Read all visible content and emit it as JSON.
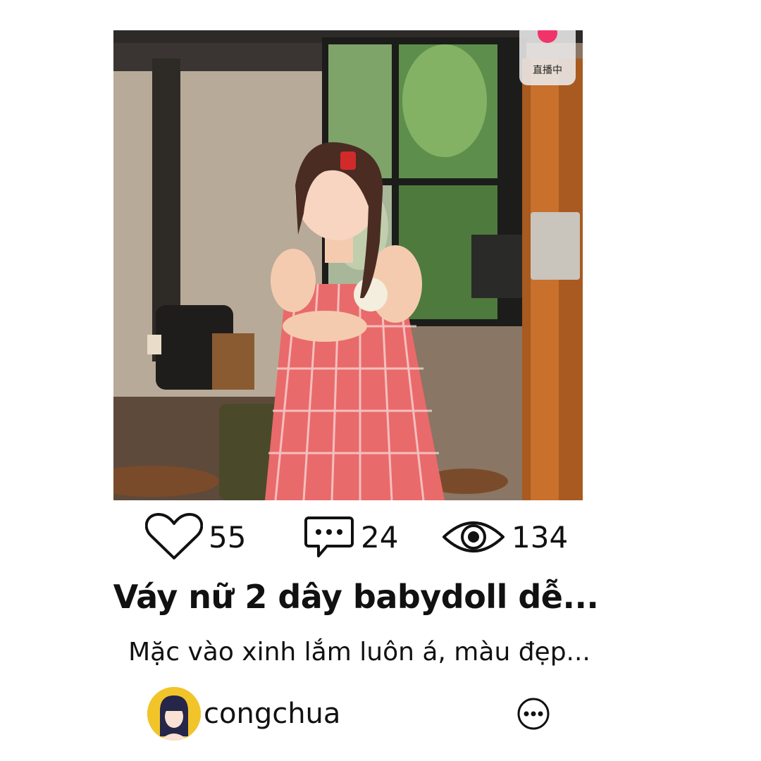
{
  "photo": {
    "description_alt": ""
  },
  "live_badge": {
    "label": "直播中",
    "icon": "live-icon",
    "color": "#f0346a"
  },
  "stats": {
    "likes": {
      "icon": "heart-icon",
      "count": "55"
    },
    "comments": {
      "icon": "comment-bubble-icon",
      "count": "24"
    },
    "views": {
      "icon": "eye-icon",
      "count": "134"
    }
  },
  "post": {
    "title": "Váy nữ 2 dây babydoll dễ...",
    "description": "Mặc vào xinh lắm luôn á, màu đẹp..."
  },
  "author": {
    "username": "congchua",
    "avatar_icon": "avatar-icon",
    "avatar_bg": "#f1c42a"
  },
  "actions": {
    "more_icon": "more-options-icon"
  }
}
